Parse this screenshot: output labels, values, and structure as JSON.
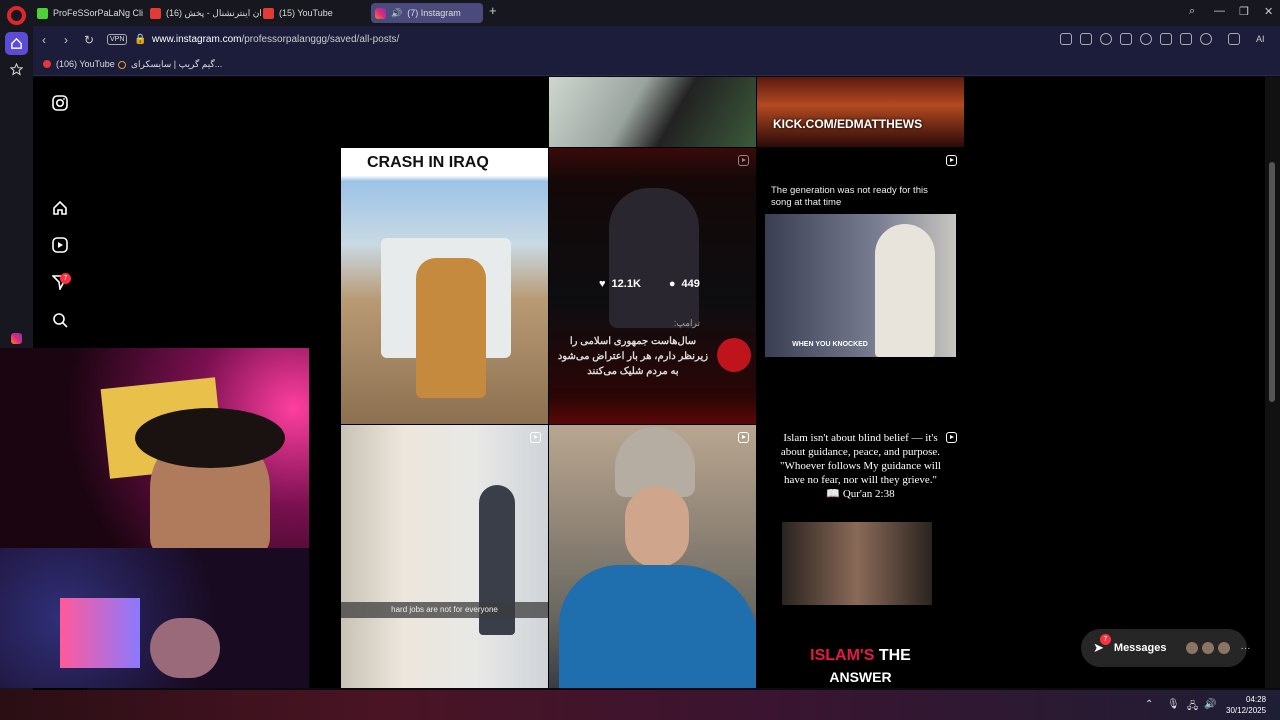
{
  "browser": {
    "tabs": [
      {
        "label": "ProFeSSorPaLaNg Clips -",
        "icon": "kick-icon"
      },
      {
        "label": "(16) ایران اینترنشنال - پخش",
        "icon": "youtube-icon"
      },
      {
        "label": "(15) YouTube",
        "icon": "youtube-icon"
      },
      {
        "label": "(7) Instagram",
        "icon": "instagram-icon",
        "active": true
      }
    ],
    "vpn_label": "VPN",
    "url_host": "www.instagram.com",
    "url_path": "/professorpalanggg/saved/all-posts/",
    "ai_label": "AI",
    "bookmarks": [
      {
        "label": "(106) YouTube"
      },
      {
        "label": "گیم گریپ | سایسکرای..."
      }
    ]
  },
  "instagram": {
    "sidebar_badge": "7",
    "posts": {
      "top_right_banner": "KICK.COM/EDMATTHEWS",
      "iraq_caption": "CRASH IN IRAQ",
      "trump_likes": "12.1K",
      "trump_comments": "449",
      "trump_farsi_label": "ترامپ:",
      "trump_farsi_line1": "سال‌هاست جمهوری اسلامی را",
      "trump_farsi_line2": "زیرنظر دارم، هر بار اعتراض می‌شود",
      "trump_farsi_line3": "به مردم شلیک می‌کنند",
      "song_caption": "The generation was not ready for this song at that time",
      "song_subtitle": "WHEN YOU KNOCKED",
      "jobs_subtitle": "hard jobs are not for everyone",
      "islam_quote_line1": "Islam isn't about blind belief — it's",
      "islam_quote_line2": "about guidance, peace, and purpose.",
      "islam_quote_line3": "\"Whoever follows My guidance will",
      "islam_quote_line4": "have no fear, nor will they grieve.\"",
      "islam_quote_line5": "📖 Qur'an 2:38",
      "islam_answer_red": "ISLAM'S",
      "islam_answer_white": "THE",
      "islam_answer_line2": "ANSWER"
    },
    "messages": {
      "label": "Messages",
      "badge": "7"
    }
  },
  "taskbar": {
    "time": "04:28",
    "date": "30/12/2025"
  },
  "colors": {
    "accent": "#5b4bd6",
    "badge": "#ff3040",
    "islam_red": "#e8174a"
  }
}
